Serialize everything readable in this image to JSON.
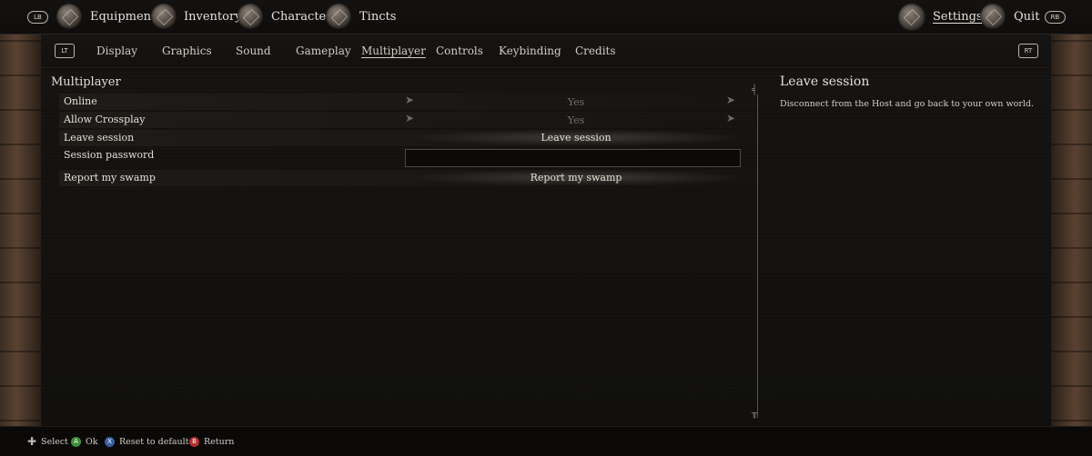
{
  "topbar": {
    "lb": "LB",
    "rb": "RB",
    "items": [
      {
        "label": "Equipment",
        "icon": "equipment-icon"
      },
      {
        "label": "Inventory",
        "icon": "inventory-icon"
      },
      {
        "label": "Character",
        "icon": "character-icon"
      },
      {
        "label": "Tincts",
        "icon": "tincts-icon"
      }
    ],
    "settings": "Settings",
    "quit": "Quit"
  },
  "tabs": {
    "lt": "LT",
    "rt": "RT",
    "items": [
      "Display",
      "Graphics",
      "Sound",
      "Gameplay",
      "Multiplayer",
      "Controls",
      "Keybinding",
      "Credits"
    ],
    "active": "Multiplayer"
  },
  "multiplayer": {
    "section_title": "Multiplayer",
    "rows": [
      {
        "label": "Online",
        "value": "Yes"
      },
      {
        "label": "Allow Crossplay",
        "value": "Yes"
      },
      {
        "label": "Leave session",
        "button": "Leave session"
      },
      {
        "label": "Session password",
        "input_value": ""
      },
      {
        "label": "Report my swamp",
        "button": "Report my swamp"
      }
    ]
  },
  "detail": {
    "title": "Leave session",
    "description": "Disconnect from the Host and go back to your own world."
  },
  "bottom_hints": [
    {
      "icon": "dpad-icon",
      "label": "Select"
    },
    {
      "icon": "a-button-icon",
      "button": "A",
      "label": "Ok",
      "color": "#3f8f3a"
    },
    {
      "icon": "x-button-icon",
      "button": "X",
      "label": "Reset to default",
      "color": "#3c5fa3"
    },
    {
      "icon": "b-button-icon",
      "button": "B",
      "label": "Return",
      "color": "#b03030"
    }
  ]
}
